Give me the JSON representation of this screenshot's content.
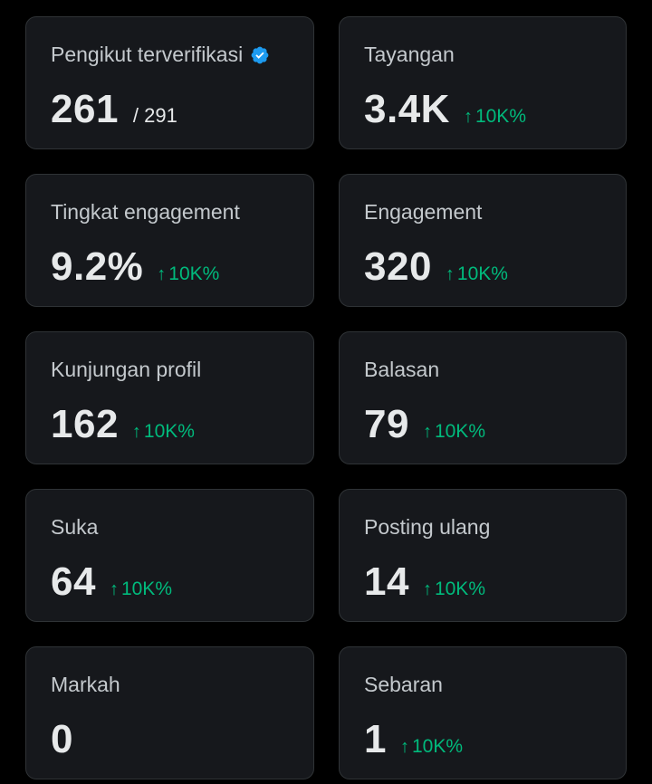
{
  "stats": [
    {
      "label": "Pengikut terverifikasi",
      "value": "261",
      "sub": "/ 291",
      "change": "",
      "verified": true
    },
    {
      "label": "Tayangan",
      "value": "3.4K",
      "sub": "",
      "change": "10K%",
      "verified": false
    },
    {
      "label": "Tingkat engagement",
      "value": "9.2%",
      "sub": "",
      "change": "10K%",
      "verified": false
    },
    {
      "label": "Engagement",
      "value": "320",
      "sub": "",
      "change": "10K%",
      "verified": false
    },
    {
      "label": "Kunjungan profil",
      "value": "162",
      "sub": "",
      "change": "10K%",
      "verified": false
    },
    {
      "label": "Balasan",
      "value": "79",
      "sub": "",
      "change": "10K%",
      "verified": false
    },
    {
      "label": "Suka",
      "value": "64",
      "sub": "",
      "change": "10K%",
      "verified": false
    },
    {
      "label": "Posting ulang",
      "value": "14",
      "sub": "",
      "change": "10K%",
      "verified": false
    },
    {
      "label": "Markah",
      "value": "0",
      "sub": "",
      "change": "",
      "verified": false
    },
    {
      "label": "Sebaran",
      "value": "1",
      "sub": "",
      "change": "10K%",
      "verified": false
    }
  ],
  "icons": {
    "verified": "verified-badge-icon",
    "arrow": "arrow-up-icon",
    "arrow_glyph": "↑"
  },
  "colors": {
    "background": "#000000",
    "card": "#16181c",
    "border": "#2f3336",
    "text": "#e7e9ea",
    "label": "#c4c9cd",
    "positive": "#00ba7c",
    "verified": "#1d9bf0"
  }
}
